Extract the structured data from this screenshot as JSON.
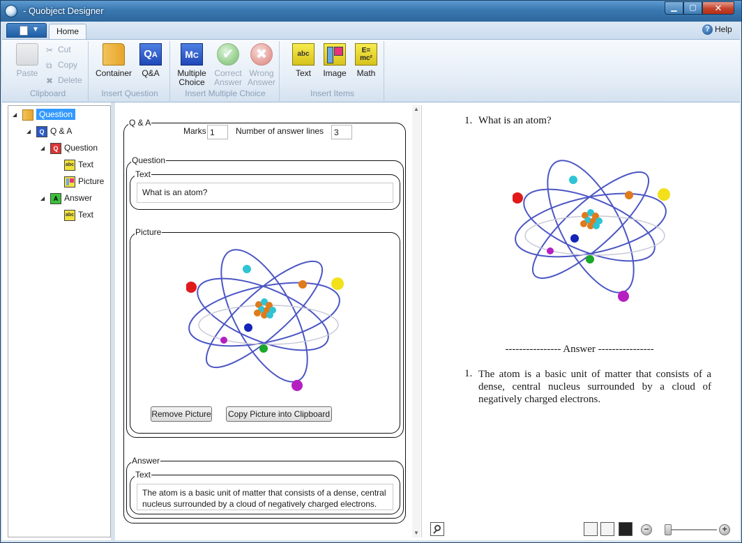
{
  "window": {
    "title": "- Quobject Designer"
  },
  "ribbon": {
    "tabs": [
      "Home"
    ],
    "help": "Help",
    "clipboard": {
      "label": "Clipboard",
      "paste": "Paste",
      "cut": "Cut",
      "copy": "Copy",
      "delete": "Delete"
    },
    "insert_question": {
      "label": "Insert Question",
      "container": "Container",
      "qa": "Q&A"
    },
    "insert_mc": {
      "label": "Insert Multiple Choice",
      "multiple": "Multiple",
      "choice": "Choice",
      "correct": "Correct",
      "wrong": "Wrong",
      "answer": "Answer"
    },
    "insert_items": {
      "label": "Insert Items",
      "text": "Text",
      "image": "Image",
      "math": "Math"
    },
    "icon_text": {
      "abc": "abc",
      "qa_q": "Q",
      "qa_a": "A",
      "mc_m": "M",
      "mc_c": "C",
      "math_e": "E=",
      "math_mc": "mc²"
    }
  },
  "tree": {
    "items": [
      {
        "label": "Question",
        "icon": "container-icon",
        "exp": "◢"
      },
      {
        "label": "Q & A",
        "icon": "qa-icon",
        "exp": "◢"
      },
      {
        "label": "Question",
        "icon": "question-icon",
        "exp": "◢"
      },
      {
        "label": "Text",
        "icon": "text-icon"
      },
      {
        "label": "Picture",
        "icon": "picture-icon"
      },
      {
        "label": "Answer",
        "icon": "answer-icon",
        "exp": "◢"
      },
      {
        "label": "Text",
        "icon": "text-icon"
      }
    ],
    "icon_text": {
      "q": "Q",
      "a": "A",
      "abc": "abc"
    }
  },
  "editor": {
    "qa_legend": "Q & A",
    "marks_label": "Marks",
    "marks_value": "1",
    "lines_label": "Number of answer lines",
    "lines_value": "3",
    "question_legend": "Question",
    "text_legend": "Text",
    "question_text": "What is an atom?",
    "picture_legend": "Picture",
    "remove_picture": "Remove Picture",
    "copy_picture": "Copy Picture into Clipboard",
    "answer_legend": "Answer",
    "answer_text_legend": "Text",
    "answer_text": "The atom is a basic unit of matter that consists of a dense, central nucleus surrounded by a cloud of negatively charged electrons."
  },
  "preview": {
    "q_number": "1.",
    "question": "What is an atom?",
    "divider": "---------------- Answer ----------------",
    "a_number": "1.",
    "answer": "The atom is a basic unit of matter that consists of a dense, central nucleus surrounded by a cloud of negatively charged electrons."
  },
  "statusbar": {
    "zoom_minus": "−",
    "zoom_plus": "+"
  }
}
